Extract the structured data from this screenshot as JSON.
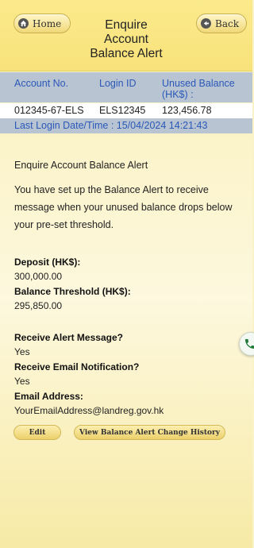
{
  "header": {
    "home_label": "Home",
    "back_label": "Back",
    "title_line1": "Enquire",
    "title_line2": "Account",
    "title_line3": "Balance Alert"
  },
  "account_table": {
    "columns": [
      "Account No.",
      "Login ID",
      "Unused Balance",
      "(HK$) :"
    ],
    "row": {
      "account_no": "012345-67-ELS",
      "login_id": "ELS12345",
      "unused_balance": "123,456.78"
    }
  },
  "last_login": "Last Login Date/Time : 15/04/2024 14:21:43",
  "section_title": "Enquire Account Balance Alert",
  "description": "You have set up the Balance Alert to receive message when your unused balance drops below your pre-set threshold.",
  "fields": {
    "deposit_label": "Deposit (HK$):",
    "deposit_value": "300,000.00",
    "threshold_label": "Balance Threshold (HK$):",
    "threshold_value": "295,850.00",
    "alert_label": "Receive Alert Message?",
    "alert_value": "Yes",
    "email_notify_label": "Receive Email Notification?",
    "email_notify_value": "Yes",
    "email_label": "Email Address:",
    "email_value": "YourEmailAddress@landreg.gov.hk"
  },
  "buttons": {
    "edit": "Edit",
    "history": "View Balance Alert Change History"
  },
  "icons": {
    "home": "home-icon",
    "back": "back-icon",
    "phone": "phone-icon"
  },
  "colors": {
    "header_bg": "#f8e27a",
    "table_header_bg": "#b9c4d3",
    "link_blue": "#2a58b8",
    "page_bg": "#fbf3c8"
  }
}
